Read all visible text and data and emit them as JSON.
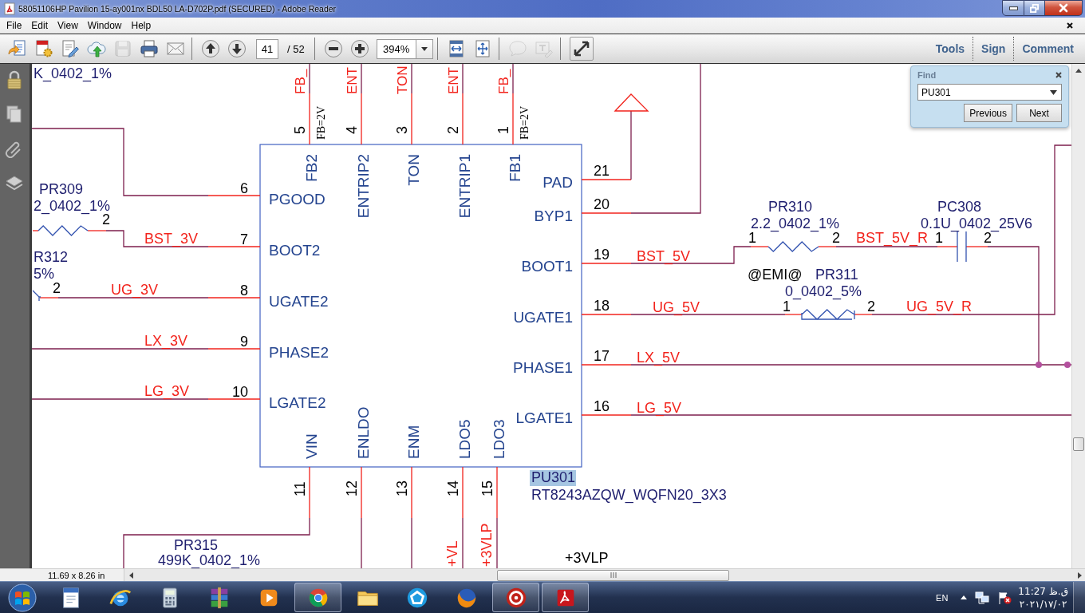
{
  "window": {
    "title": "58051106HP Pavilion 15-ay001nx BDL50 LA-D702P.pdf (SECURED) - Adobe Reader"
  },
  "menu_bar": [
    "File",
    "Edit",
    "View",
    "Window",
    "Help"
  ],
  "toolbar": {
    "groups": [
      [
        {
          "kind": "create",
          "disabled": false
        },
        {
          "kind": "combine",
          "disabled": false
        },
        {
          "kind": "edit",
          "disabled": false
        },
        {
          "kind": "upload",
          "disabled": false
        },
        {
          "kind": "save",
          "disabled": true
        },
        {
          "kind": "print",
          "disabled": false
        },
        {
          "kind": "email",
          "disabled": false
        }
      ],
      [
        {
          "kind": "previous_page",
          "disabled": false
        },
        {
          "kind": "next_page",
          "disabled": false
        },
        {
          "kind": "page_field",
          "value": "41"
        },
        {
          "kind": "page_count",
          "text": "/ 52"
        }
      ],
      [
        {
          "kind": "zoom_out",
          "disabled": false
        },
        {
          "kind": "zoom_in",
          "disabled": false
        },
        {
          "kind": "zoom_field",
          "value": "394%"
        }
      ],
      [
        {
          "kind": "scroll_mode",
          "disabled": false
        },
        {
          "kind": "fit_page",
          "disabled": false
        }
      ],
      [
        {
          "kind": "sticky_note",
          "disabled": true
        },
        {
          "kind": "highlight",
          "disabled": true
        }
      ],
      [
        {
          "kind": "read_mode",
          "disabled": false
        }
      ]
    ],
    "panes": [
      "Tools",
      "Sign",
      "Comment"
    ]
  },
  "find_panel": {
    "title": "Find",
    "query": "PU301",
    "buttons": [
      "Previous",
      "Next"
    ]
  },
  "schematic": {
    "chip": {
      "reference": "PU301",
      "reference_highlighted": true,
      "part_number": "RT8243AZQW_WQFN20_3X3",
      "top_pins": [
        {
          "number": "5",
          "name": "FB2",
          "net": "FB_",
          "note": "FB=2V"
        },
        {
          "number": "4",
          "name": "ENTRIP2",
          "net": "ENT"
        },
        {
          "number": "3",
          "name": "TON",
          "net": "TON"
        },
        {
          "number": "2",
          "name": "ENTRIP1",
          "net": "ENT"
        },
        {
          "number": "1",
          "name": "FB1",
          "net": "FB_",
          "note": "FB=2V"
        }
      ],
      "left_pins": [
        {
          "number": "6",
          "name": "PGOOD"
        },
        {
          "number": "7",
          "name": "BOOT2",
          "net": "BST_3V"
        },
        {
          "number": "8",
          "name": "UGATE2",
          "net": "UG_3V"
        },
        {
          "number": "9",
          "name": "PHASE2",
          "net": "LX_3V"
        },
        {
          "number": "10",
          "name": "LGATE2",
          "net": "LG_3V"
        }
      ],
      "right_pins": [
        {
          "number": "21",
          "name": "PAD"
        },
        {
          "number": "20",
          "name": "BYP1"
        },
        {
          "number": "19",
          "name": "BOOT1",
          "net": "BST_5V"
        },
        {
          "number": "18",
          "name": "UGATE1",
          "net": "UG_5V"
        },
        {
          "number": "17",
          "name": "PHASE1",
          "net": "LX_5V"
        },
        {
          "number": "16",
          "name": "LGATE1",
          "net": "LG_5V"
        }
      ],
      "bottom_pins": [
        {
          "number": "11",
          "name": "VIN"
        },
        {
          "number": "12",
          "name": "ENLDO"
        },
        {
          "number": "13",
          "name": "ENM"
        },
        {
          "number": "14",
          "name": "LDO5",
          "net": "+VL"
        },
        {
          "number": "15",
          "name": "LDO3",
          "net": "+3VLP"
        }
      ]
    },
    "parts": [
      {
        "value": "K_0402_1%"
      },
      {
        "kind": "resistor",
        "reference": "PR309",
        "value": "2_0402_1%",
        "pins": [
          "2"
        ]
      },
      {
        "reference": "R312",
        "value": "5%",
        "pins": [
          "2"
        ]
      },
      {
        "reference": "PR315",
        "value": "499K_0402_1%"
      },
      {
        "kind": "resistor",
        "reference": "PR310",
        "value": "2.2_0402_1%",
        "pins": [
          "1",
          "2"
        ]
      },
      {
        "kind": "capacitor",
        "reference": "PC308",
        "value": "0.1U_0402_25V6",
        "pins": [
          "1",
          "2"
        ]
      },
      {
        "kind": "resistor",
        "note": "@EMI@",
        "reference": "PR311",
        "value": "0_0402_5%",
        "pins": [
          "1",
          "2"
        ]
      }
    ],
    "net_labels": [
      {
        "kind": "signal",
        "text": "BST_5V_R"
      },
      {
        "kind": "signal",
        "text": "UG_5V_R"
      },
      {
        "kind": "power",
        "text": "+3VLP"
      }
    ]
  },
  "status_bar": {
    "page_size": "11.69 x 8.26 in"
  },
  "taskbar": {
    "apps": [
      {
        "kind": "document",
        "running": false
      },
      {
        "kind": "ringed_globe",
        "running": false
      },
      {
        "kind": "calculator",
        "running": false
      },
      {
        "kind": "archiver",
        "running": false
      },
      {
        "kind": "media_player",
        "running": false
      },
      {
        "kind": "tricolor_browser",
        "running": true
      },
      {
        "kind": "file_explorer",
        "running": false
      },
      {
        "kind": "pentagon_app",
        "running": false
      },
      {
        "kind": "fox_browser",
        "running": false
      },
      {
        "kind": "red_circle_app",
        "running": true
      },
      {
        "kind": "pdf_reader",
        "running": true
      }
    ],
    "language": "EN",
    "time": "ق.ظ 11:27",
    "date": "٢٠٢١/١٧/٠٢"
  }
}
